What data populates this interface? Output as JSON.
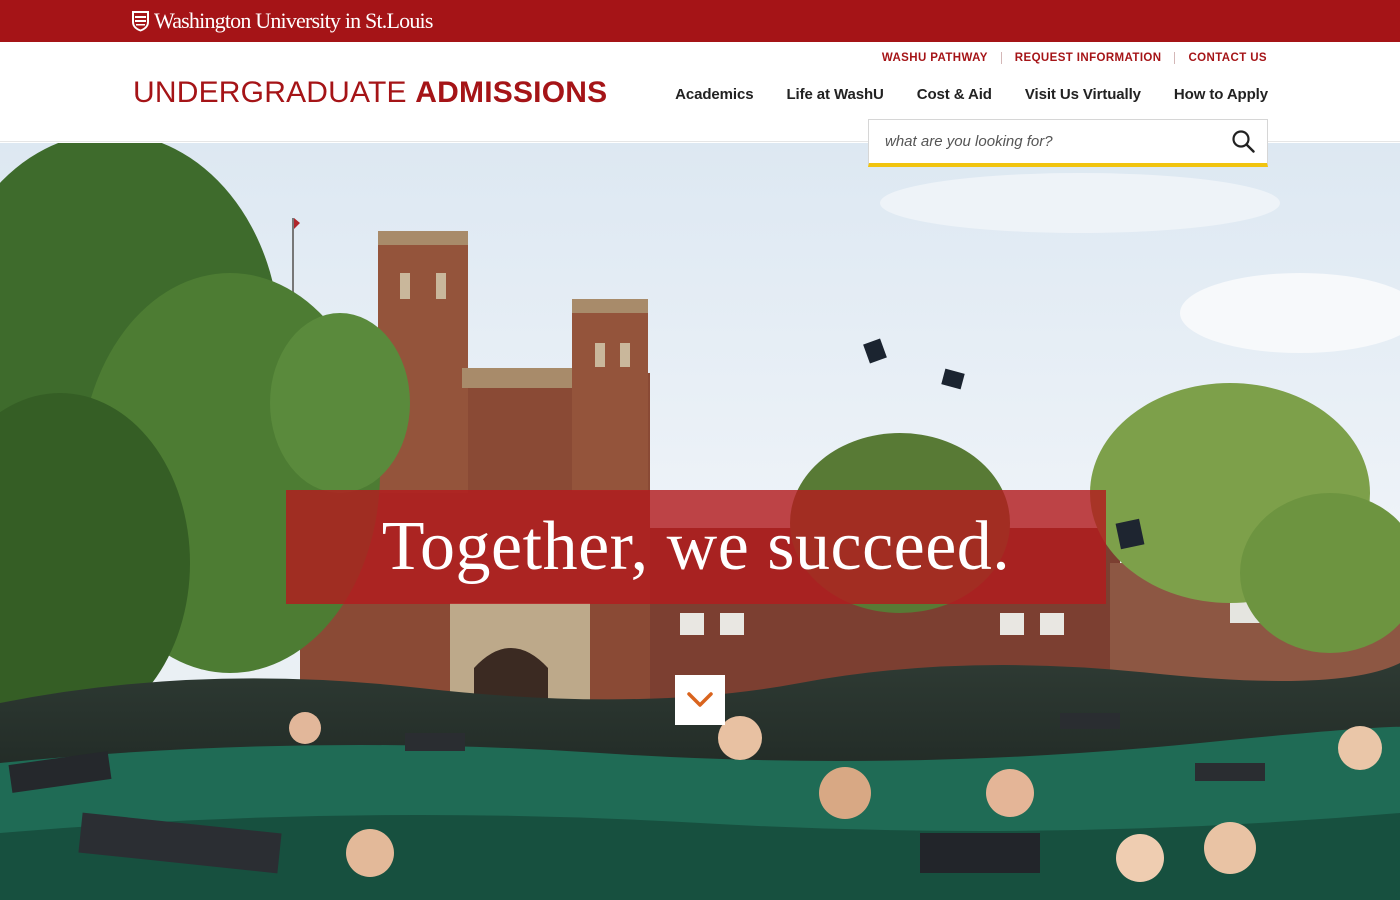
{
  "brand": {
    "university_name": "Washington University in St.Louis",
    "shield_icon": "wustl-shield-icon",
    "bar_color": "#a51417"
  },
  "utility_nav": [
    {
      "label": "WASHU PATHWAY"
    },
    {
      "label": "REQUEST INFORMATION"
    },
    {
      "label": "CONTACT US"
    }
  ],
  "site_title": {
    "light": "UNDERGRADUATE",
    "bold": "ADMISSIONS"
  },
  "main_nav": [
    {
      "label": "Academics"
    },
    {
      "label": "Life at WashU"
    },
    {
      "label": "Cost & Aid"
    },
    {
      "label": "Visit Us Virtually"
    },
    {
      "label": "How to Apply"
    }
  ],
  "search": {
    "placeholder": "what are you looking for?",
    "value": "",
    "icon": "search-icon",
    "accent_color": "#f1c40f"
  },
  "hero": {
    "tagline": "Together, we succeed.",
    "scroll_icon": "chevron-down-icon",
    "image_subject": "graduation-crowd-photo",
    "scroll_icon_color": "#d9641e"
  }
}
